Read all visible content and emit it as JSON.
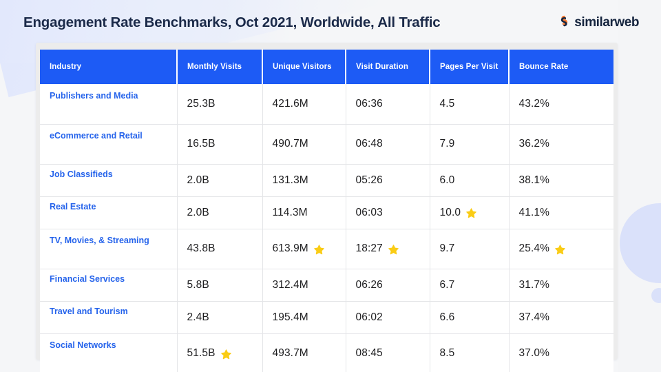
{
  "header": {
    "title": "Engagement Rate Benchmarks, Oct 2021, Worldwide, All Traffic",
    "brand": "similarweb",
    "brand_icon": "similarweb-swirl-icon"
  },
  "theme": {
    "header_blue": "#1D5BF5",
    "link_blue": "#2563EB",
    "title_navy": "#1B2A49",
    "star_yellow": "#FACC15",
    "page_bg": "#F5F6F8",
    "card_bg": "#ECECEC",
    "row_divider": "#E4E5E8"
  },
  "table": {
    "columns": [
      {
        "key": "industry",
        "label": "Industry"
      },
      {
        "key": "visits",
        "label": "Monthly Visits"
      },
      {
        "key": "unique",
        "label": "Unique Visitors"
      },
      {
        "key": "duration",
        "label": "Visit Duration"
      },
      {
        "key": "pages",
        "label": "Pages Per Visit"
      },
      {
        "key": "bounce",
        "label": "Bounce Rate"
      }
    ],
    "rows": [
      {
        "industry": "Publishers and Media",
        "visits": "25.3B",
        "visits_star": false,
        "unique": "421.6M",
        "unique_star": false,
        "duration": "06:36",
        "duration_star": false,
        "pages": "4.5",
        "pages_star": false,
        "bounce": "43.2%",
        "bounce_star": false,
        "tall": true
      },
      {
        "industry": "eCommerce and Retail",
        "visits": "16.5B",
        "visits_star": false,
        "unique": "490.7M",
        "unique_star": false,
        "duration": "06:48",
        "duration_star": false,
        "pages": "7.9",
        "pages_star": false,
        "bounce": "36.2%",
        "bounce_star": false,
        "tall": true
      },
      {
        "industry": "Job Classifieds",
        "visits": "2.0B",
        "visits_star": false,
        "unique": "131.3M",
        "unique_star": false,
        "duration": "05:26",
        "duration_star": false,
        "pages": "6.0",
        "pages_star": false,
        "bounce": "38.1%",
        "bounce_star": false,
        "tall": false
      },
      {
        "industry": "Real Estate",
        "visits": "2.0B",
        "visits_star": false,
        "unique": "114.3M",
        "unique_star": false,
        "duration": "06:03",
        "duration_star": false,
        "pages": "10.0",
        "pages_star": true,
        "bounce": "41.1%",
        "bounce_star": false,
        "tall": false
      },
      {
        "industry": "TV, Movies, & Streaming",
        "visits": "43.8B",
        "visits_star": false,
        "unique": "613.9M",
        "unique_star": true,
        "duration": "18:27",
        "duration_star": true,
        "pages": "9.7",
        "pages_star": false,
        "bounce": "25.4%",
        "bounce_star": true,
        "tall": true
      },
      {
        "industry": "Financial Services",
        "visits": "5.8B",
        "visits_star": false,
        "unique": "312.4M",
        "unique_star": false,
        "duration": "06:26",
        "duration_star": false,
        "pages": "6.7",
        "pages_star": false,
        "bounce": "31.7%",
        "bounce_star": false,
        "tall": false
      },
      {
        "industry": "Travel and Tourism",
        "visits": "2.4B",
        "visits_star": false,
        "unique": "195.4M",
        "unique_star": false,
        "duration": "06:02",
        "duration_star": false,
        "pages": "6.6",
        "pages_star": false,
        "bounce": "37.4%",
        "bounce_star": false,
        "tall": false
      },
      {
        "industry": "Social Networks",
        "visits": "51.5B",
        "visits_star": true,
        "unique": "493.7M",
        "unique_star": false,
        "duration": "08:45",
        "duration_star": false,
        "pages": "8.5",
        "pages_star": false,
        "bounce": "37.0%",
        "bounce_star": false,
        "tall": true
      }
    ]
  },
  "icons": {
    "star": "star-icon"
  }
}
